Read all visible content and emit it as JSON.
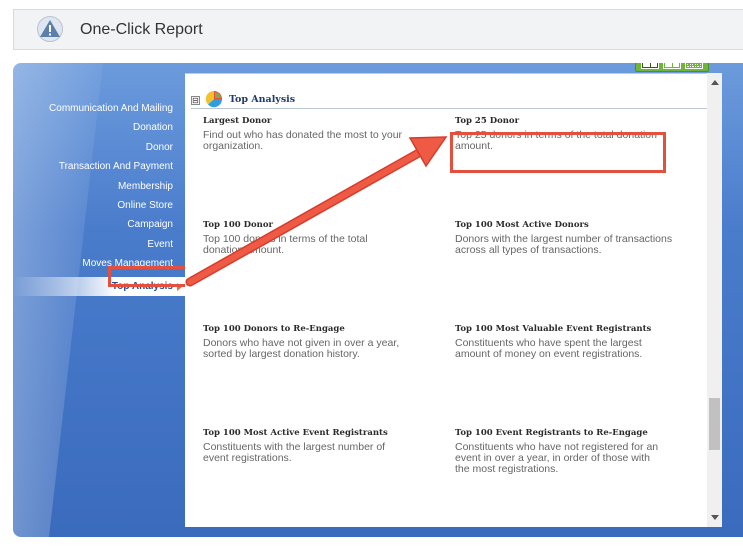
{
  "header": {
    "title": "One-Click Report",
    "icon": "warning-triangle-icon"
  },
  "view_toggle": {
    "icons": [
      "list-view-icon",
      "card-view-icon",
      "grid-view-icon"
    ]
  },
  "nav": {
    "items": [
      {
        "label": "Communication And Mailing"
      },
      {
        "label": "Donation"
      },
      {
        "label": "Donor"
      },
      {
        "label": "Transaction And Payment"
      },
      {
        "label": "Membership"
      },
      {
        "label": "Online Store"
      },
      {
        "label": "Campaign"
      },
      {
        "label": "Event"
      },
      {
        "label": "Moves Management"
      },
      {
        "label": "Top Analysis",
        "active": true
      }
    ]
  },
  "section": {
    "title": "Top Analysis",
    "toggle": "⊟"
  },
  "reports": [
    {
      "title": "Largest Donor",
      "desc": "Find out who has donated the most to your organization."
    },
    {
      "title": "Top 25 Donor",
      "desc": "Top 25 donors in terms of the total donation amount."
    },
    {
      "title": "Top 100 Donor",
      "desc": "Top 100 donors in terms of the total donation amount."
    },
    {
      "title": "Top 100 Most Active Donors",
      "desc": "Donors with the largest number of transactions across all types of transactions."
    },
    {
      "title": "Top 100 Donors to Re-Engage",
      "desc": "Donors who have not given in over a year, sorted by largest donation history."
    },
    {
      "title": "Top 100 Most Valuable Event Registrants",
      "desc": "Constituents who have spent the largest amount of money on event registrations."
    },
    {
      "title": "Top 100 Most Active Event Registrants",
      "desc": "Constituents with the largest number of event registrations."
    },
    {
      "title": "Top 100 Event Registrants to Re-Engage",
      "desc": "Constituents who have not registered for an event in over a year, in order of those with the most registrations."
    }
  ],
  "colors": {
    "accent": "#3a6bbd",
    "annotation": "#e3503d",
    "toggle": "#6fb53a"
  }
}
